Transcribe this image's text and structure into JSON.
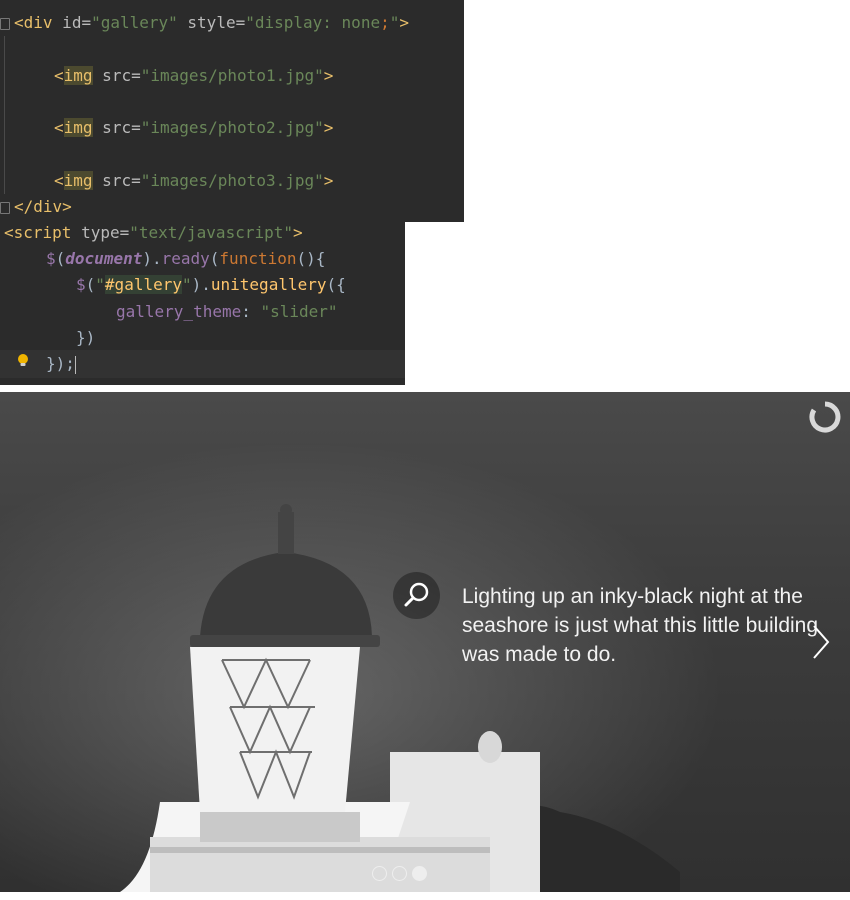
{
  "editor_top": {
    "line1": {
      "open": "<",
      "tag": "div",
      "attr1": " id=",
      "val1": "\"gallery\"",
      "attr2": " style=",
      "val2": "\"display: none",
      "semi": ";",
      "val2end": "\"",
      "close": ">"
    },
    "img_lines": [
      {
        "open": "<",
        "tag": "img",
        "attr": " src=",
        "val": "\"images/photo1.jpg\"",
        "close": ">"
      },
      {
        "open": "<",
        "tag": "img",
        "attr": " src=",
        "val": "\"images/photo2.jpg\"",
        "close": ">"
      },
      {
        "open": "<",
        "tag": "img",
        "attr": " src=",
        "val": "\"images/photo3.jpg\"",
        "close": ">"
      }
    ],
    "line_close": "</div>"
  },
  "editor_bottom": {
    "script_open": {
      "open": "<",
      "tag": "script",
      "attr": " type=",
      "val": "\"text/javascript\"",
      "close": ">"
    },
    "ready": {
      "dollar": "$",
      "paren1": "(",
      "doc": "document",
      "paren2": ").",
      "fn": "ready",
      "paren3": "(",
      "kw": "function",
      "rest": "(){"
    },
    "gallery": {
      "dollar": "$",
      "paren1": "(",
      "q1": "\"",
      "sel": "#gallery",
      "q2": "\"",
      "paren2": ").",
      "fn": "unitegallery",
      "rest": "({"
    },
    "theme": {
      "prop": "gallery_theme",
      "colon": ": ",
      "val": "\"slider\""
    },
    "close_inner": "})",
    "close_outer": "});"
  },
  "slider": {
    "caption": "Lighting up an inky-black night at the seashore is just what this little building was made to do.",
    "bullets": [
      {
        "active": false
      },
      {
        "active": false
      },
      {
        "active": true
      }
    ],
    "icons": {
      "zoom": "zoom-icon",
      "next": "chevron-right-icon",
      "loader": "loader-icon"
    }
  }
}
